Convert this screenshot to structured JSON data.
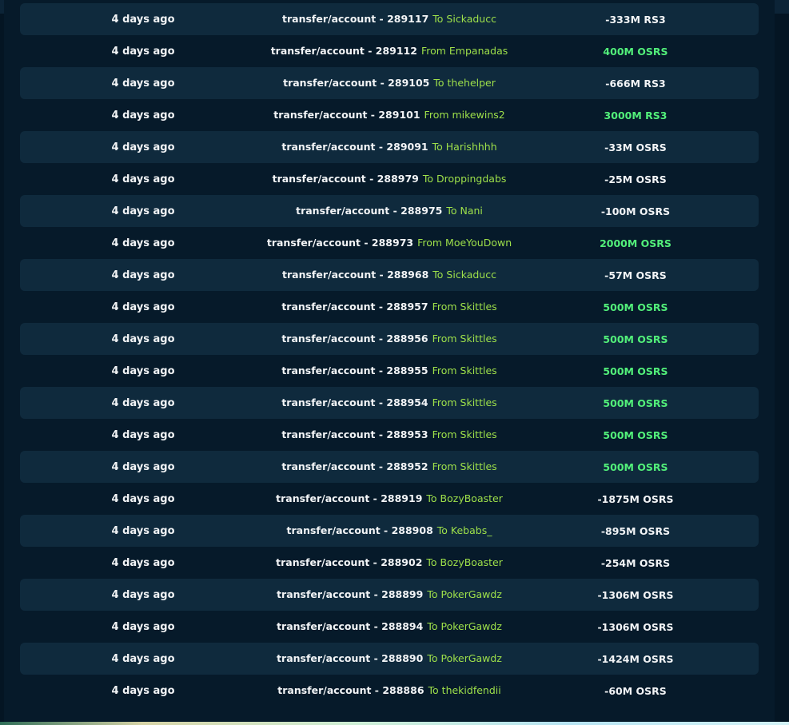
{
  "transactions": [
    {
      "time": "4 days ago",
      "ref": "transfer/account - 289117",
      "party": "To Sickaducc",
      "amount": "-333M RS3",
      "positive": false
    },
    {
      "time": "4 days ago",
      "ref": "transfer/account - 289112",
      "party": "From Empanadas",
      "amount": "400M OSRS",
      "positive": true
    },
    {
      "time": "4 days ago",
      "ref": "transfer/account - 289105",
      "party": "To thehelper",
      "amount": "-666M RS3",
      "positive": false
    },
    {
      "time": "4 days ago",
      "ref": "transfer/account - 289101",
      "party": "From mikewins2",
      "amount": "3000M RS3",
      "positive": true
    },
    {
      "time": "4 days ago",
      "ref": "transfer/account - 289091",
      "party": "To Harishhhh",
      "amount": "-33M OSRS",
      "positive": false
    },
    {
      "time": "4 days ago",
      "ref": "transfer/account - 288979",
      "party": "To Droppingdabs",
      "amount": "-25M OSRS",
      "positive": false
    },
    {
      "time": "4 days ago",
      "ref": "transfer/account - 288975",
      "party": "To Nani",
      "amount": "-100M OSRS",
      "positive": false
    },
    {
      "time": "4 days ago",
      "ref": "transfer/account - 288973",
      "party": "From MoeYouDown",
      "amount": "2000M OSRS",
      "positive": true
    },
    {
      "time": "4 days ago",
      "ref": "transfer/account - 288968",
      "party": "To Sickaducc",
      "amount": "-57M OSRS",
      "positive": false
    },
    {
      "time": "4 days ago",
      "ref": "transfer/account - 288957",
      "party": "From Skittles",
      "amount": "500M OSRS",
      "positive": true
    },
    {
      "time": "4 days ago",
      "ref": "transfer/account - 288956",
      "party": "From Skittles",
      "amount": "500M OSRS",
      "positive": true
    },
    {
      "time": "4 days ago",
      "ref": "transfer/account - 288955",
      "party": "From Skittles",
      "amount": "500M OSRS",
      "positive": true
    },
    {
      "time": "4 days ago",
      "ref": "transfer/account - 288954",
      "party": "From Skittles",
      "amount": "500M OSRS",
      "positive": true
    },
    {
      "time": "4 days ago",
      "ref": "transfer/account - 288953",
      "party": "From Skittles",
      "amount": "500M OSRS",
      "positive": true
    },
    {
      "time": "4 days ago",
      "ref": "transfer/account - 288952",
      "party": "From Skittles",
      "amount": "500M OSRS",
      "positive": true
    },
    {
      "time": "4 days ago",
      "ref": "transfer/account - 288919",
      "party": "To BozyBoaster",
      "amount": "-1875M OSRS",
      "positive": false
    },
    {
      "time": "4 days ago",
      "ref": "transfer/account - 288908",
      "party": "To Kebabs_",
      "amount": "-895M OSRS",
      "positive": false
    },
    {
      "time": "4 days ago",
      "ref": "transfer/account - 288902",
      "party": "To BozyBoaster",
      "amount": "-254M OSRS",
      "positive": false
    },
    {
      "time": "4 days ago",
      "ref": "transfer/account - 288899",
      "party": "To PokerGawdz",
      "amount": "-1306M OSRS",
      "positive": false
    },
    {
      "time": "4 days ago",
      "ref": "transfer/account - 288894",
      "party": "To PokerGawdz",
      "amount": "-1306M OSRS",
      "positive": false
    },
    {
      "time": "4 days ago",
      "ref": "transfer/account - 288890",
      "party": "To PokerGawdz",
      "amount": "-1424M OSRS",
      "positive": false
    },
    {
      "time": "4 days ago",
      "ref": "transfer/account - 288886",
      "party": "To thekidfendii",
      "amount": "-60M OSRS",
      "positive": false
    }
  ],
  "colors": {
    "background": "#041523",
    "row_alt": "#0f2a3d",
    "party_text": "#9ee04a",
    "positive_amount": "#52f07a",
    "text": "#f2f4f6"
  }
}
